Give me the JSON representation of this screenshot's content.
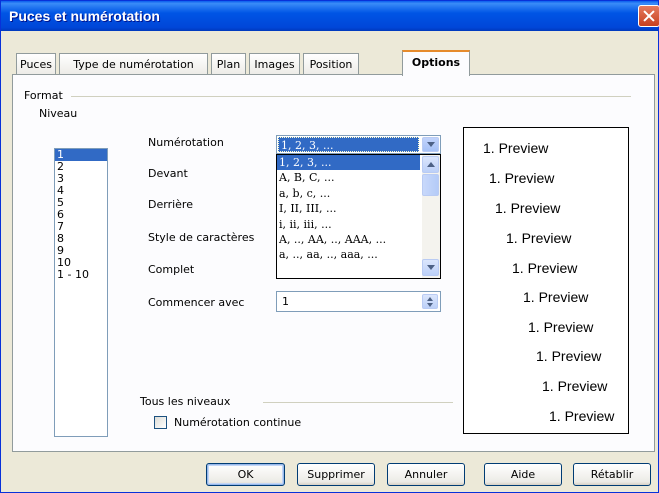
{
  "window": {
    "title": "Puces et numérotation"
  },
  "tabs": [
    {
      "label": "Puces"
    },
    {
      "label": "Type de numérotation"
    },
    {
      "label": "Plan"
    },
    {
      "label": "Images"
    },
    {
      "label": "Position"
    },
    {
      "label": "Options"
    }
  ],
  "format": {
    "group_label": "Format",
    "niveau_label": "Niveau",
    "levels": [
      "1",
      "2",
      "3",
      "4",
      "5",
      "6",
      "7",
      "8",
      "9",
      "10",
      "1 - 10"
    ],
    "selected_level": "1"
  },
  "fields": {
    "numerotation_label": "Numérotation",
    "devant_label": "Devant",
    "derriere_label": "Derrière",
    "style_label": "Style de caractères",
    "complet_label": "Complet",
    "commencer_label": "Commencer avec",
    "numerotation_value": "1, 2, 3, ...",
    "commencer_value": "1"
  },
  "dropdown": {
    "options": [
      "1, 2, 3, ...",
      "A, B, C, ...",
      "a, b, c, ...",
      "I, II, III, ...",
      "i, ii, iii, ...",
      "A, .., AA, .., AAA, ...",
      "a, .., aa, .., aaa, ..."
    ]
  },
  "preview": {
    "lines": [
      "1. Preview",
      "1. Preview",
      "1. Preview",
      "1. Preview",
      "1. Preview",
      "1. Preview",
      "1. Preview",
      "1. Preview",
      "1. Preview",
      "1. Preview"
    ]
  },
  "all_levels": {
    "group_label": "Tous les niveaux",
    "checkbox_label": "Numérotation continue",
    "checked": false
  },
  "buttons": {
    "ok": "OK",
    "delete": "Supprimer",
    "cancel": "Annuler",
    "help": "Aide",
    "reset": "Rétablir"
  }
}
